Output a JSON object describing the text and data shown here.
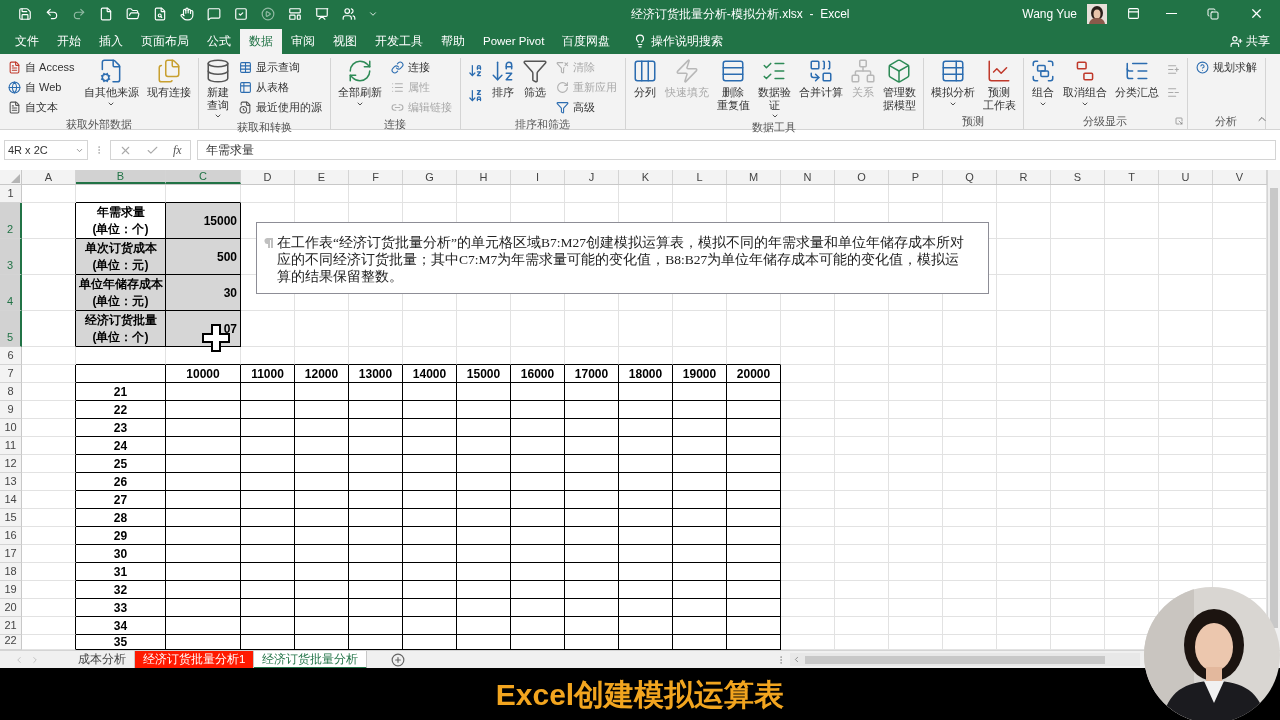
{
  "title_bar": {
    "title": "经济订货批量分析-模拟分析.xlsx  -  Excel",
    "user": "Wang Yue"
  },
  "menu_tabs": [
    {
      "label": "文件",
      "selected": false
    },
    {
      "label": "开始",
      "selected": false
    },
    {
      "label": "插入",
      "selected": false
    },
    {
      "label": "页面布局",
      "selected": false
    },
    {
      "label": "公式",
      "selected": false
    },
    {
      "label": "数据",
      "selected": true
    },
    {
      "label": "审阅",
      "selected": false
    },
    {
      "label": "视图",
      "selected": false
    },
    {
      "label": "开发工具",
      "selected": false
    },
    {
      "label": "帮助",
      "selected": false
    },
    {
      "label": "Power Pivot",
      "selected": false
    },
    {
      "label": "百度网盘",
      "selected": false
    }
  ],
  "tell_me": "操作说明搜索",
  "share": "共享",
  "ribbon": [
    {
      "label": "获取外部数据",
      "items": [
        {
          "kind": "stack",
          "items": [
            {
              "label": "自 Access",
              "disabled": false
            },
            {
              "label": "自 Web",
              "disabled": false
            },
            {
              "label": "自文本",
              "disabled": false
            }
          ]
        },
        {
          "kind": "large",
          "lines": [
            "自其他来源"
          ],
          "dropdown": true,
          "disabled": false
        },
        {
          "kind": "large",
          "lines": [
            "现有连接"
          ],
          "disabled": false
        }
      ]
    },
    {
      "label": "获取和转换",
      "items": [
        {
          "kind": "large",
          "lines": [
            "新建",
            "查询"
          ],
          "dropdown": true,
          "disabled": false
        },
        {
          "kind": "stack",
          "items": [
            {
              "label": "显示查询",
              "disabled": false
            },
            {
              "label": "从表格",
              "disabled": false
            },
            {
              "label": "最近使用的源",
              "disabled": false
            }
          ]
        }
      ]
    },
    {
      "label": "连接",
      "items": [
        {
          "kind": "large",
          "lines": [
            "全部刷新"
          ],
          "dropdown": true,
          "disabled": false
        },
        {
          "kind": "stack",
          "items": [
            {
              "label": "连接",
              "disabled": false
            },
            {
              "label": "属性",
              "disabled": true
            },
            {
              "label": "编辑链接",
              "disabled": true
            }
          ]
        }
      ]
    },
    {
      "label": "排序和筛选",
      "items": [
        {
          "kind": "sort_pair"
        },
        {
          "kind": "large",
          "lines": [
            "排序"
          ],
          "disabled": false
        },
        {
          "kind": "large",
          "lines": [
            "筛选"
          ],
          "disabled": false
        },
        {
          "kind": "stack",
          "items": [
            {
              "label": "清除",
              "disabled": true
            },
            {
              "label": "重新应用",
              "disabled": true
            },
            {
              "label": "高级",
              "disabled": false
            }
          ]
        }
      ]
    },
    {
      "label": "数据工具",
      "items": [
        {
          "kind": "large",
          "lines": [
            "分列"
          ],
          "disabled": false
        },
        {
          "kind": "large",
          "lines": [
            "快速填充"
          ],
          "disabled": true
        },
        {
          "kind": "large",
          "lines": [
            "删除",
            "重复值"
          ],
          "disabled": false
        },
        {
          "kind": "large",
          "lines": [
            "数据验",
            "证"
          ],
          "dropdown": true,
          "disabled": false
        },
        {
          "kind": "large",
          "lines": [
            "合并计算"
          ],
          "disabled": false
        },
        {
          "kind": "large",
          "lines": [
            "关系"
          ],
          "disabled": true
        },
        {
          "kind": "large",
          "lines": [
            "管理数",
            "据模型"
          ],
          "disabled": false
        }
      ]
    },
    {
      "label": "预测",
      "items": [
        {
          "kind": "large",
          "lines": [
            "模拟分析"
          ],
          "dropdown": true,
          "disabled": false
        },
        {
          "kind": "large",
          "lines": [
            "预测",
            "工作表"
          ],
          "disabled": false
        }
      ]
    },
    {
      "label": "分级显示",
      "launcher": true,
      "items": [
        {
          "kind": "large",
          "lines": [
            "组合"
          ],
          "dropdown": true,
          "disabled": false
        },
        {
          "kind": "large",
          "lines": [
            "取消组合"
          ],
          "dropdown": true,
          "disabled": false
        },
        {
          "kind": "large",
          "lines": [
            "分类汇总"
          ],
          "disabled": false
        },
        {
          "kind": "outline_pair"
        }
      ]
    },
    {
      "label": "分析",
      "items": [
        {
          "kind": "stack",
          "items": [
            {
              "label": "规划求解",
              "disabled": false
            }
          ]
        }
      ]
    }
  ],
  "name_box": "4R x 2C",
  "function_label": "fx",
  "formula": "年需求量",
  "columns": [
    {
      "label": "A",
      "selected": false
    },
    {
      "label": "B",
      "selected": true
    },
    {
      "label": "C",
      "selected": true
    },
    {
      "label": "D",
      "selected": false
    },
    {
      "label": "E",
      "selected": false
    },
    {
      "label": "F",
      "selected": false
    },
    {
      "label": "G",
      "selected": false
    },
    {
      "label": "H",
      "selected": false
    },
    {
      "label": "I",
      "selected": false
    },
    {
      "label": "J",
      "selected": false
    },
    {
      "label": "K",
      "selected": false
    },
    {
      "label": "L",
      "selected": false
    },
    {
      "label": "M",
      "selected": false
    },
    {
      "label": "N",
      "selected": false
    },
    {
      "label": "O",
      "selected": false
    },
    {
      "label": "P",
      "selected": false
    },
    {
      "label": "Q",
      "selected": false
    },
    {
      "label": "R",
      "selected": false
    },
    {
      "label": "S",
      "selected": false
    },
    {
      "label": "T",
      "selected": false
    },
    {
      "label": "U",
      "selected": false
    },
    {
      "label": "V",
      "selected": false
    }
  ],
  "rows": [
    {
      "label": "1",
      "selected": false
    },
    {
      "label": "2",
      "selected": true
    },
    {
      "label": "3",
      "selected": true
    },
    {
      "label": "4",
      "selected": true
    },
    {
      "label": "5",
      "selected": true
    },
    {
      "label": "6",
      "selected": false
    },
    {
      "label": "7",
      "selected": false
    },
    {
      "label": "8",
      "selected": false
    },
    {
      "label": "9",
      "selected": false
    },
    {
      "label": "10",
      "selected": false
    },
    {
      "label": "11",
      "selected": false
    },
    {
      "label": "12",
      "selected": false
    },
    {
      "label": "13",
      "selected": false
    },
    {
      "label": "14",
      "selected": false
    },
    {
      "label": "15",
      "selected": false
    },
    {
      "label": "16",
      "selected": false
    },
    {
      "label": "17",
      "selected": false
    },
    {
      "label": "18",
      "selected": false
    },
    {
      "label": "19",
      "selected": false
    },
    {
      "label": "20",
      "selected": false
    },
    {
      "label": "21",
      "selected": false
    },
    {
      "label": "22",
      "selected": false
    }
  ],
  "parameters": [
    {
      "label": "年需求量",
      "unit": "(单位：个)",
      "value": "15000",
      "active": true
    },
    {
      "label": "单次订货成本",
      "unit": "(单位：元)",
      "value": "500",
      "active": false
    },
    {
      "label": "单位年储存成本",
      "unit": "(单位：元)",
      "value": "30",
      "active": false
    },
    {
      "label": "经济订货批量",
      "unit": "(单位：个)",
      "value": "07",
      "active": false
    }
  ],
  "data_table": {
    "demand_values": [
      "10000",
      "11000",
      "12000",
      "13000",
      "14000",
      "15000",
      "16000",
      "17000",
      "18000",
      "19000",
      "20000"
    ],
    "cost_values": [
      "21",
      "22",
      "23",
      "24",
      "25",
      "26",
      "27",
      "28",
      "29",
      "30",
      "31",
      "32",
      "33",
      "34",
      "35"
    ]
  },
  "instruction": "在工作表“经济订货批量分析”的单元格区域B7:M27创建模拟运算表，模拟不同的年需求量和单位年储存成本所对应的不同经济订货批量；其中C7:M7为年需求量可能的变化值，B8:B27为单位年储存成本可能的变化值，模拟运算的结果保留整数。",
  "sheet_tabs": [
    {
      "label": "成本分析",
      "selected": false
    },
    {
      "label": "经济订货批量分析1",
      "selected": false,
      "color": "#ff1a00"
    },
    {
      "label": "经济订货批量分析",
      "selected": true
    }
  ],
  "caption": "Excel创建模拟运算表"
}
